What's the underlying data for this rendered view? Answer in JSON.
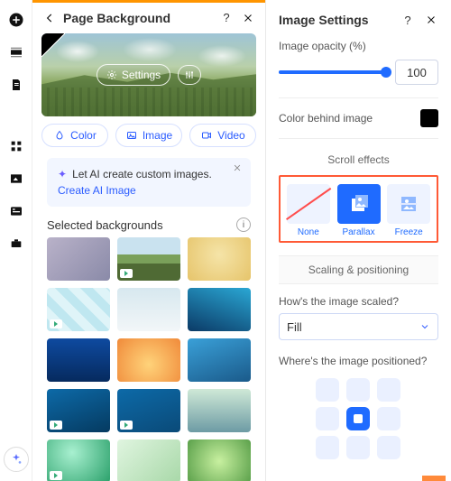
{
  "center": {
    "title": "Page Background",
    "hero_settings_label": "Settings",
    "tabs": {
      "color": "Color",
      "image": "Image",
      "video": "Video"
    },
    "ai_banner": {
      "text": "Let AI create custom images.",
      "link": "Create AI Image"
    },
    "selected_label": "Selected backgrounds"
  },
  "right": {
    "title": "Image Settings",
    "opacity_label": "Image opacity (%)",
    "opacity_value": "100",
    "color_behind_label": "Color behind image",
    "color_behind_value": "#000000",
    "scroll_effects_label": "Scroll effects",
    "scroll_effects": {
      "none": "None",
      "parallax": "Parallax",
      "freeze": "Freeze"
    },
    "scaling_label": "Scaling & positioning",
    "scale_q": "How's the image scaled?",
    "scale_value": "Fill",
    "pos_q": "Where's the image positioned?"
  },
  "thumbs": [
    {
      "bg": "linear-gradient(135deg,#b9b2c9,#8a8aa8)",
      "video": false
    },
    {
      "bg": "linear-gradient(180deg,#c9e2ef 0 40%,#7aa05a 40% 60%,#4f6a34 60%)",
      "video": true
    },
    {
      "bg": "radial-gradient(circle at 50% 40%,#f5e4a8,#e6c46a)",
      "video": false
    },
    {
      "bg": "repeating-linear-gradient(45deg,#bfe7f0 0 10px,#dff4f8 10px 20px)",
      "video": true
    },
    {
      "bg": "linear-gradient(180deg,#d7e8ef,#f2f6f8)",
      "video": false
    },
    {
      "bg": "linear-gradient(200deg,#2aa7d4,#0b3a66)",
      "video": false
    },
    {
      "bg": "linear-gradient(180deg,#0e4aa0,#062a5e)",
      "video": false
    },
    {
      "bg": "radial-gradient(circle at 50% 60%,#ffd37a,#f08a3a)",
      "video": false
    },
    {
      "bg": "linear-gradient(160deg,#3aa0d8,#1a5a8a)",
      "video": false
    },
    {
      "bg": "linear-gradient(160deg,#0d6aa8,#053a60)",
      "video": true
    },
    {
      "bg": "linear-gradient(160deg,#0d6aa8,#0a4a78)",
      "video": true
    },
    {
      "bg": "linear-gradient(180deg,#cfe9d7,#6d9ba4)",
      "video": false
    },
    {
      "bg": "radial-gradient(circle at 40% 30%,#a8f0d0,#2aa06a)",
      "video": true
    },
    {
      "bg": "linear-gradient(135deg,#e0f5e0,#a8d8a8)",
      "video": false
    },
    {
      "bg": "radial-gradient(circle at 50% 50%,#c8f0a0,#5aa04a)",
      "video": false
    }
  ]
}
